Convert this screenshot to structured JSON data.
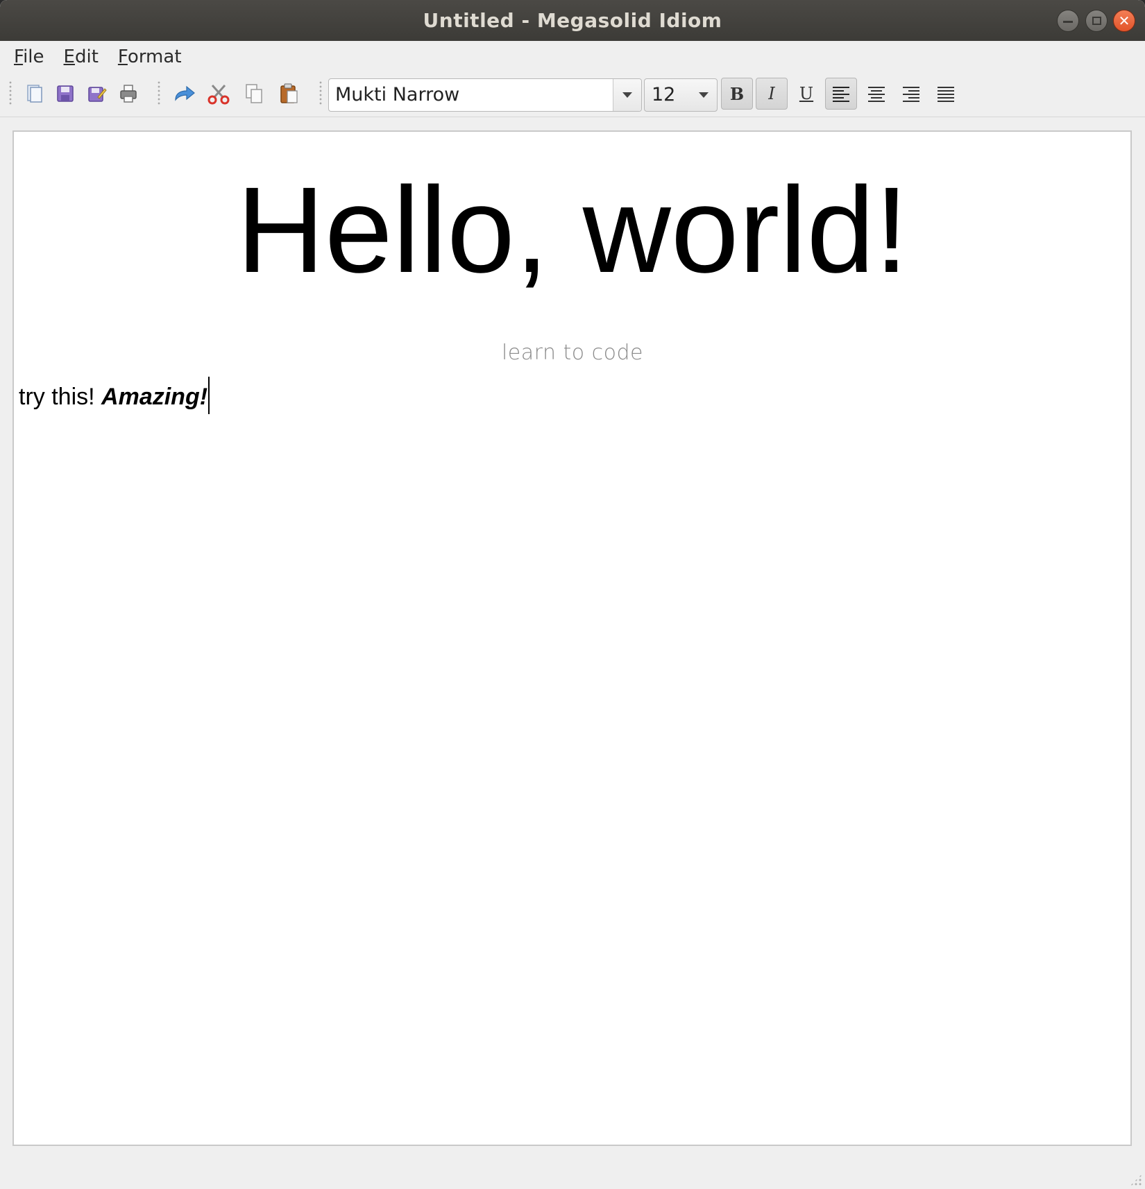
{
  "window": {
    "title": "Untitled - Megasolid Idiom"
  },
  "menubar": {
    "items": [
      {
        "mnemonic": "F",
        "rest": "ile"
      },
      {
        "mnemonic": "E",
        "rest": "dit"
      },
      {
        "mnemonic": "F",
        "rest": "ormat"
      }
    ]
  },
  "toolbar": {
    "file_actions": [
      "open-file-icon",
      "save-icon",
      "save-as-icon",
      "print-icon"
    ],
    "edit_actions": [
      "redo-icon",
      "cut-icon",
      "copy-icon",
      "paste-icon"
    ],
    "font_family": "Mukti Narrow",
    "font_size": "12",
    "bold_label": "B",
    "italic_label": "I",
    "underline_label": "U",
    "bold_checked": false,
    "italic_checked": true,
    "align_left_checked": true
  },
  "document": {
    "heading": "Hello, world!",
    "subtitle": "learn to code",
    "line_plain": "try this! ",
    "line_emphasis": "Amazing!"
  },
  "colors": {
    "titlebar": "#3c3b37",
    "close_button": "#e2542a",
    "window_bg": "#efefef",
    "subtitle_text": "#8a8a8a"
  }
}
